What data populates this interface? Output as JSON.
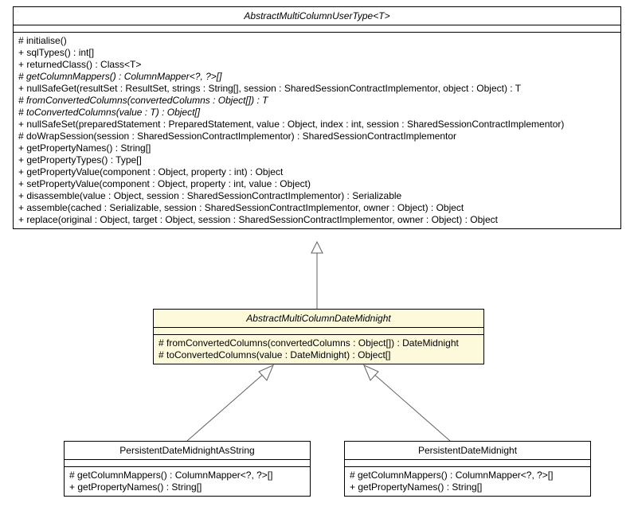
{
  "chart_data": {
    "type": "uml-class-diagram",
    "classes": [
      {
        "id": "top",
        "name": "AbstractMultiColumnUserType<T>",
        "abstract": true,
        "methods": [
          "# initialise()",
          "+ sqlTypes() : int[]",
          "+ returnedClass() : Class<T>",
          "# getColumnMappers() : ColumnMapper<?, ?>[]",
          "+ nullSafeGet(resultSet : ResultSet, strings : String[], session : SharedSessionContractImplementor, object : Object) : T",
          "# fromConvertedColumns(convertedColumns : Object[]) : T",
          "# toConvertedColumns(value : T) : Object[]",
          "+ nullSafeSet(preparedStatement : PreparedStatement, value : Object, index : int, session : SharedSessionContractImplementor)",
          "# doWrapSession(session : SharedSessionContractImplementor) : SharedSessionContractImplementor",
          "+ getPropertyNames() : String[]",
          "+ getPropertyTypes() : Type[]",
          "+ getPropertyValue(component : Object, property : int) : Object",
          "+ setPropertyValue(component : Object, property : int, value : Object)",
          "+ disassemble(value : Object, session : SharedSessionContractImplementor) : Serializable",
          "+ assemble(cached : Serializable, session : SharedSessionContractImplementor, owner : Object) : Object",
          "+ replace(original : Object, target : Object, session : SharedSessionContractImplementor, owner : Object) : Object"
        ],
        "italic_methods": [
          3,
          5,
          6
        ]
      },
      {
        "id": "mid",
        "name": "AbstractMultiColumnDateMidnight",
        "abstract": true,
        "methods": [
          "# fromConvertedColumns(convertedColumns : Object[]) : DateMidnight",
          "# toConvertedColumns(value : DateMidnight) : Object[]"
        ],
        "italic_methods": []
      },
      {
        "id": "left",
        "name": "PersistentDateMidnightAsString",
        "abstract": false,
        "methods": [
          "# getColumnMappers() : ColumnMapper<?, ?>[]",
          "+ getPropertyNames() : String[]"
        ],
        "italic_methods": []
      },
      {
        "id": "right",
        "name": "PersistentDateMidnight",
        "abstract": false,
        "methods": [
          "# getColumnMappers() : ColumnMapper<?, ?>[]",
          "+ getPropertyNames() : String[]"
        ],
        "italic_methods": []
      }
    ],
    "generalizations": [
      {
        "from": "mid",
        "to": "top"
      },
      {
        "from": "left",
        "to": "mid"
      },
      {
        "from": "right",
        "to": "mid"
      }
    ]
  }
}
